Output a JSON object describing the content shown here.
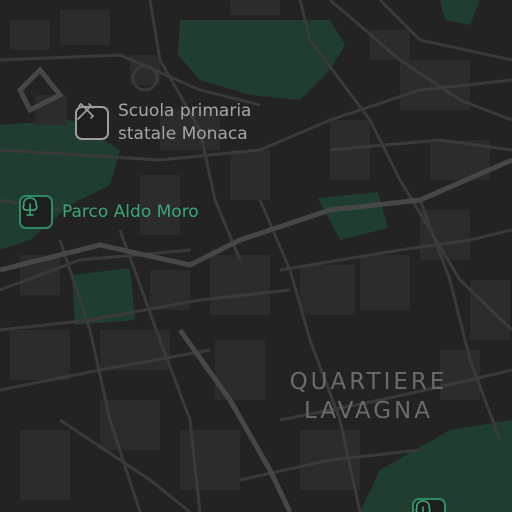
{
  "map": {
    "colors": {
      "background": "#232323",
      "block": "#2b2b2b",
      "road": "#3a3a3a",
      "major_road": "#484848",
      "park": "#1f3d31"
    },
    "pois": {
      "school": {
        "label": "Scuola primaria\nstatale Monaca",
        "icon": "school-icon",
        "color": "#a6a6a6"
      },
      "park": {
        "label": "Parco Aldo Moro",
        "icon": "tree-icon",
        "color": "#39a875"
      },
      "bottom": {
        "icon": "tree-icon",
        "color": "#39a875"
      }
    },
    "district_label": "QUARTIERE\nLAVAGNA"
  }
}
